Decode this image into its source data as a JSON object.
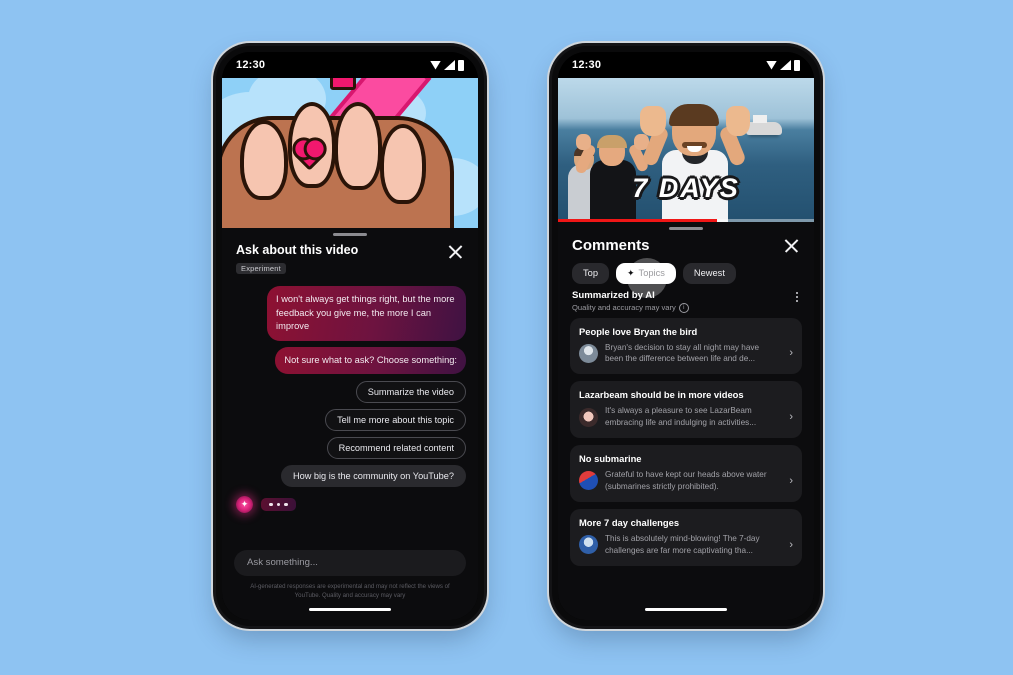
{
  "background_color": "#8ec3f2",
  "phone_left": {
    "status_bar": {
      "time": "12:30",
      "icons": [
        "wifi-icon",
        "signal-icon",
        "battery-icon"
      ]
    },
    "video": {
      "title_overlay": "",
      "illustration": "animated-nails-closeup"
    },
    "sheet": {
      "title": "Ask about this video",
      "badge": "Experiment",
      "close_label": "×"
    },
    "messages": [
      {
        "role": "assistant",
        "text": "I won't always get things right, but the more feedback you give me, the more I can improve"
      },
      {
        "role": "assistant",
        "text": "Not sure what to ask? Choose something:"
      }
    ],
    "suggestions": [
      {
        "label": "Summarize the video",
        "style": "outline"
      },
      {
        "label": "Tell me more about this topic",
        "style": "outline"
      },
      {
        "label": "Recommend related content",
        "style": "outline"
      },
      {
        "label": "How big is the community on YouTube?",
        "style": "filled"
      }
    ],
    "typing_indicator": {
      "avatar": "ai-sparkle-icon",
      "dots": 3
    },
    "composer": {
      "placeholder": "Ask something...",
      "value": ""
    },
    "disclaimer": "AI-generated responses are experimental and may not reflect the views of YouTube. Quality and accuracy may vary"
  },
  "phone_right": {
    "status_bar": {
      "time": "12:30",
      "icons": [
        "wifi-icon",
        "signal-icon",
        "battery-icon"
      ]
    },
    "video": {
      "title_overlay": "7 DAYS",
      "progress_percent": 62,
      "progress_color": "#f01616"
    },
    "sheet": {
      "title": "Comments",
      "close_label": "×"
    },
    "filters": [
      {
        "label": "Top",
        "selected": false
      },
      {
        "label": "Topics",
        "selected": true,
        "icon": "sparkle-icon"
      },
      {
        "label": "Newest",
        "selected": false
      }
    ],
    "summary_header": {
      "title": "Summarized by AI",
      "subtitle": "Quality and accuracy may vary",
      "info_icon": "info-icon",
      "menu_icon": "kebab-menu-icon"
    },
    "topics": [
      {
        "title": "People love Bryan the bird",
        "snippet": "Bryan's decision to stay all night may have been the difference between life and de...",
        "avatar": "avatar-1"
      },
      {
        "title": "Lazarbeam should be in more videos",
        "snippet": "It's always a pleasure to see LazarBeam embracing life and indulging in activities...",
        "avatar": "avatar-2"
      },
      {
        "title": "No submarine",
        "snippet": "Grateful to have kept our heads above water (submarines strictly prohibited).",
        "avatar": "avatar-3"
      },
      {
        "title": "More 7 day challenges",
        "snippet": "This is absolutely mind-blowing! The 7-day challenges are far more captivating tha...",
        "avatar": "avatar-4"
      }
    ]
  }
}
